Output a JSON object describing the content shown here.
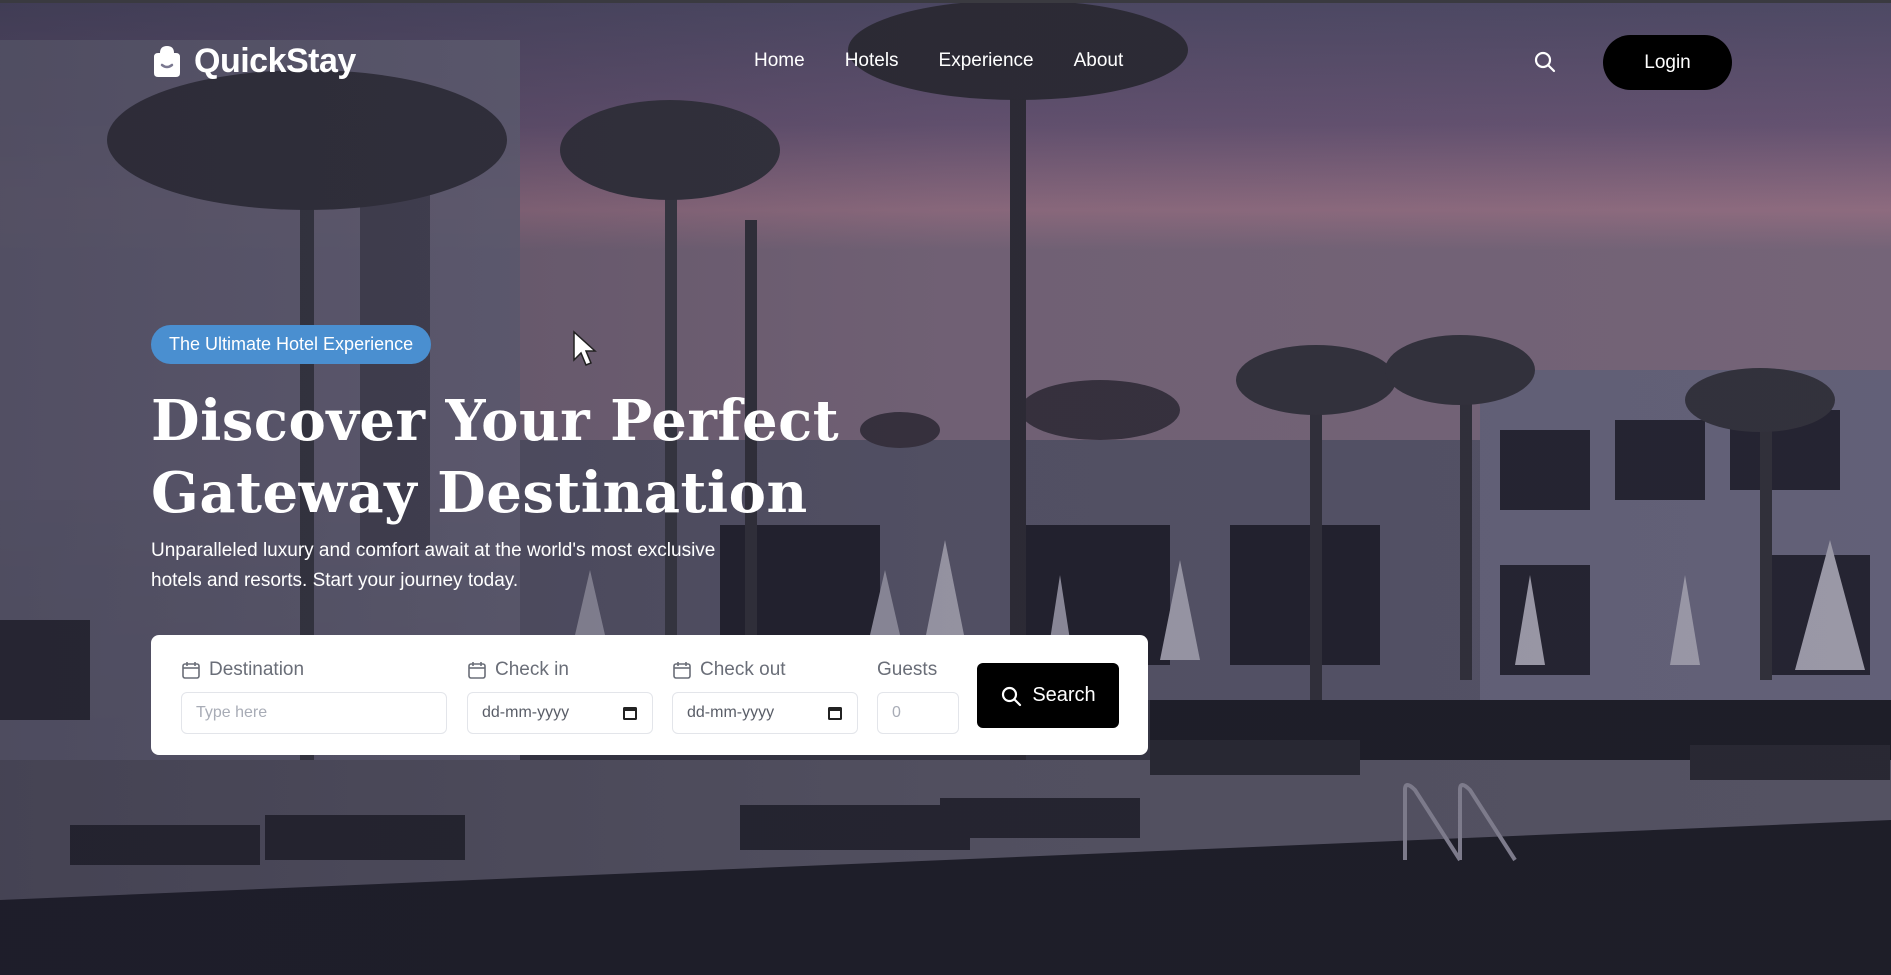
{
  "brand": {
    "name": "QuickStay",
    "logo_icon": "bag-logo-icon"
  },
  "nav": {
    "links": [
      "Home",
      "Hotels",
      "Experience",
      "About"
    ],
    "search_icon": "search-icon",
    "login_label": "Login"
  },
  "hero": {
    "badge": "The Ultimate Hotel Experience",
    "title_line1": "Discover Your Perfect",
    "title_line2": "Gateway Destination",
    "subtitle_line1": "Unparalleled luxury and comfort await at the world's most exclusive",
    "subtitle_line2": "hotels and resorts. Start your journey today."
  },
  "search_form": {
    "destination": {
      "label": "Destination",
      "placeholder": "Type here",
      "icon": "calendar-icon"
    },
    "check_in": {
      "label": "Check in",
      "value": "dd-mm-yyyy",
      "icon": "calendar-icon"
    },
    "check_out": {
      "label": "Check out",
      "value": "dd-mm-yyyy",
      "icon": "calendar-icon"
    },
    "guests": {
      "label": "Guests",
      "placeholder": "0"
    },
    "submit_label": "Search",
    "submit_icon": "search-icon"
  },
  "colors": {
    "badge_bg": "#4a8fd0",
    "button_bg": "#000000",
    "card_bg": "#ffffff"
  }
}
